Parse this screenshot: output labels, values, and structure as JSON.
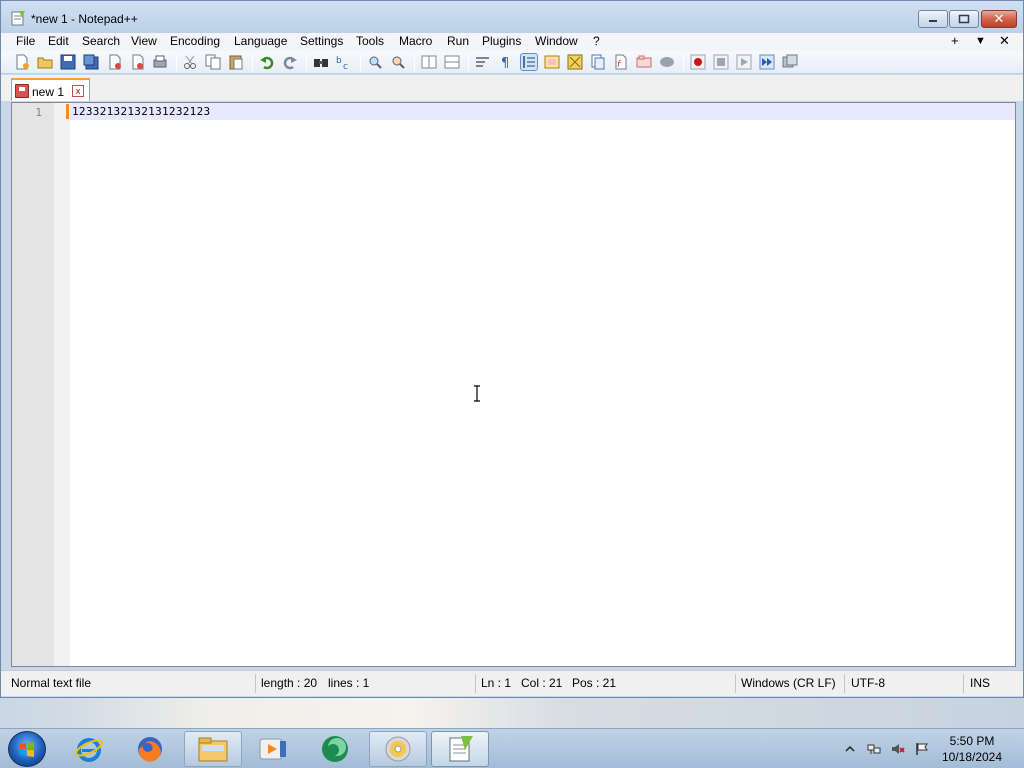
{
  "window": {
    "title": "*new 1 - Notepad++",
    "icon": "notepad-plus-plus-icon",
    "controls": {
      "minimize": "minimize-icon",
      "maximize": "maximize-icon",
      "close_glyph": "✕"
    }
  },
  "menu": {
    "items": [
      "File",
      "Edit",
      "Search",
      "View",
      "Encoding",
      "Language",
      "Settings",
      "Tools",
      "Macro",
      "Run",
      "Plugins",
      "Window",
      "?"
    ],
    "right": {
      "plus": "+",
      "down": "▼",
      "close": "✕"
    }
  },
  "toolbar": {
    "icons": [
      "new-file-icon",
      "open-file-icon",
      "save-icon",
      "save-all-icon",
      "close-icon",
      "close-all-icon",
      "print-icon",
      "cut-icon",
      "copy-icon",
      "paste-icon",
      "undo-icon",
      "redo-icon",
      "find-icon",
      "replace-icon",
      "zoom-in-icon",
      "zoom-out-icon",
      "sync-vertical-icon",
      "sync-horizontal-icon",
      "word-wrap-icon",
      "show-all-chars-icon",
      "indent-guide-icon",
      "udl-icon",
      "doc-map-icon",
      "function-list-icon",
      "folder-workspace-icon",
      "monitoring-icon",
      "record-macro-icon",
      "stop-macro-icon",
      "play-macro-icon",
      "run-macro-multiple-icon",
      "save-macro-icon"
    ]
  },
  "tabs": [
    {
      "label": "new 1",
      "close_glyph": "x"
    }
  ],
  "editor": {
    "line_number": "1",
    "content": "12332132132131232123"
  },
  "status": {
    "file_type": "Normal text file",
    "length": "length : 20",
    "lines": "lines : 1",
    "ln": "Ln : 1",
    "col": "Col : 21",
    "pos": "Pos : 21",
    "eol": "Windows (CR LF)",
    "encoding": "UTF-8",
    "mode": "INS"
  },
  "taskbar": {
    "apps": [
      "internet-explorer-icon",
      "firefox-icon",
      "file-explorer-icon",
      "media-player-icon",
      "green-app-icon",
      "disc-icon",
      "notepad-plus-plus-icon"
    ],
    "tray": [
      "show-hidden-icons-icon",
      "network-icon",
      "volume-muted-icon",
      "action-center-flag-icon"
    ],
    "time": "5:50 PM",
    "date": "10/18/2024"
  }
}
